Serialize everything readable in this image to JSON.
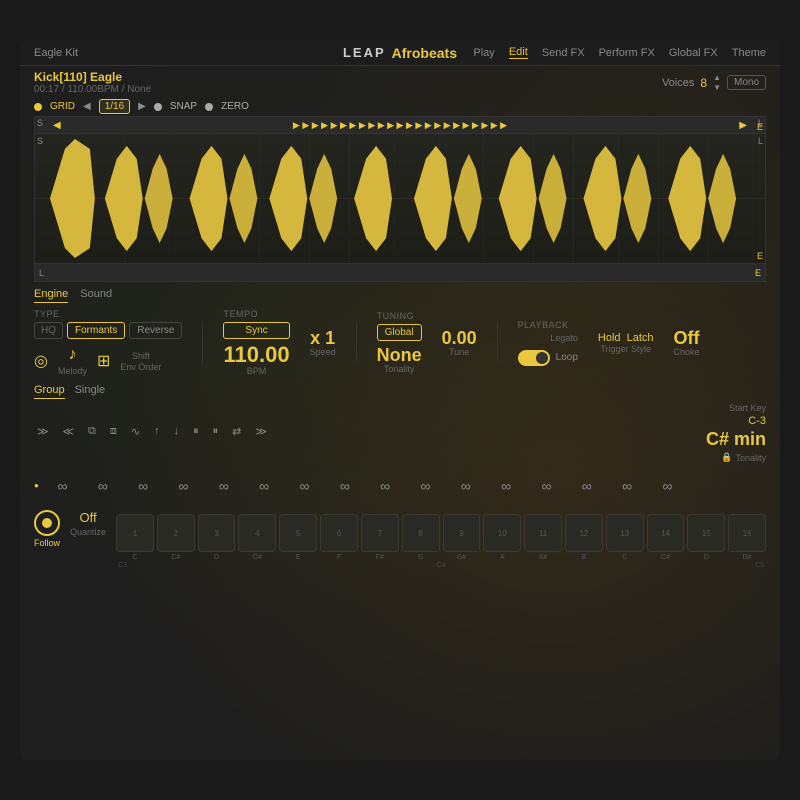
{
  "app": {
    "kit": "Eagle Kit",
    "logo": "LEAP",
    "appName": "Afrobeats",
    "nav": [
      "Play",
      "Edit",
      "Send FX",
      "Perform FX",
      "Global FX",
      "Theme"
    ],
    "activeNav": "Edit"
  },
  "track": {
    "name": "Kick[110] Eagle",
    "time": "00:17",
    "bpm": "110.00BPM",
    "key": "None",
    "voices_label": "Voices",
    "voices_num": "8",
    "mono_label": "Mono"
  },
  "grid": {
    "grid_label": "GRID",
    "grid_value": "1/16",
    "snap_label": "SNAP",
    "zero_label": "ZERO"
  },
  "engine": {
    "tabs": [
      "Engine",
      "Sound"
    ],
    "activeTab": "Engine",
    "type_label": "TYPE",
    "hq_label": "HQ",
    "formants_label": "Formants",
    "reverse_label": "Reverse",
    "tempo_label": "TEMPO",
    "sync_label": "Sync",
    "tuning_label": "TUNING",
    "global_label": "Global",
    "playback_label": "PLAYBACK",
    "legato_label": "Legato",
    "bpm_value": "110.00",
    "bpm_label": "BPM",
    "speed_value": "x 1",
    "speed_label": "Speed",
    "tonality_value": "None",
    "tonality_label": "Tonality",
    "tune_value": "0.00",
    "tune_label": "Tune",
    "loop_label": "Loop",
    "hold_label": "Hold",
    "latch_label": "Latch",
    "trigger_style_label": "Trigger Style",
    "off_label": "Off",
    "choke_label": "Choke",
    "melody_label": "Melody",
    "shift_label": "Shift",
    "env_order_label": "Env Order"
  },
  "group": {
    "tabs": [
      "Group",
      "Single"
    ],
    "activeTab": "Group",
    "start_key_label": "Start Key",
    "start_key_value": "C-3",
    "tonality_value": "C# min",
    "tonality_label": "Tonality"
  },
  "pads": {
    "numbers": [
      "1",
      "2",
      "3",
      "4",
      "5",
      "6",
      "7",
      "8",
      "9",
      "10",
      "11",
      "12",
      "13",
      "14",
      "15",
      "16"
    ],
    "c3_label": "C3",
    "c4_label": "C4",
    "c5_label": "C5"
  },
  "follow": {
    "label": "Follow"
  },
  "quantize": {
    "label": "Quantize",
    "value": "Off"
  },
  "colors": {
    "accent": "#e8c840",
    "bg": "#1e1e1e",
    "dark": "#2a2a2a"
  }
}
